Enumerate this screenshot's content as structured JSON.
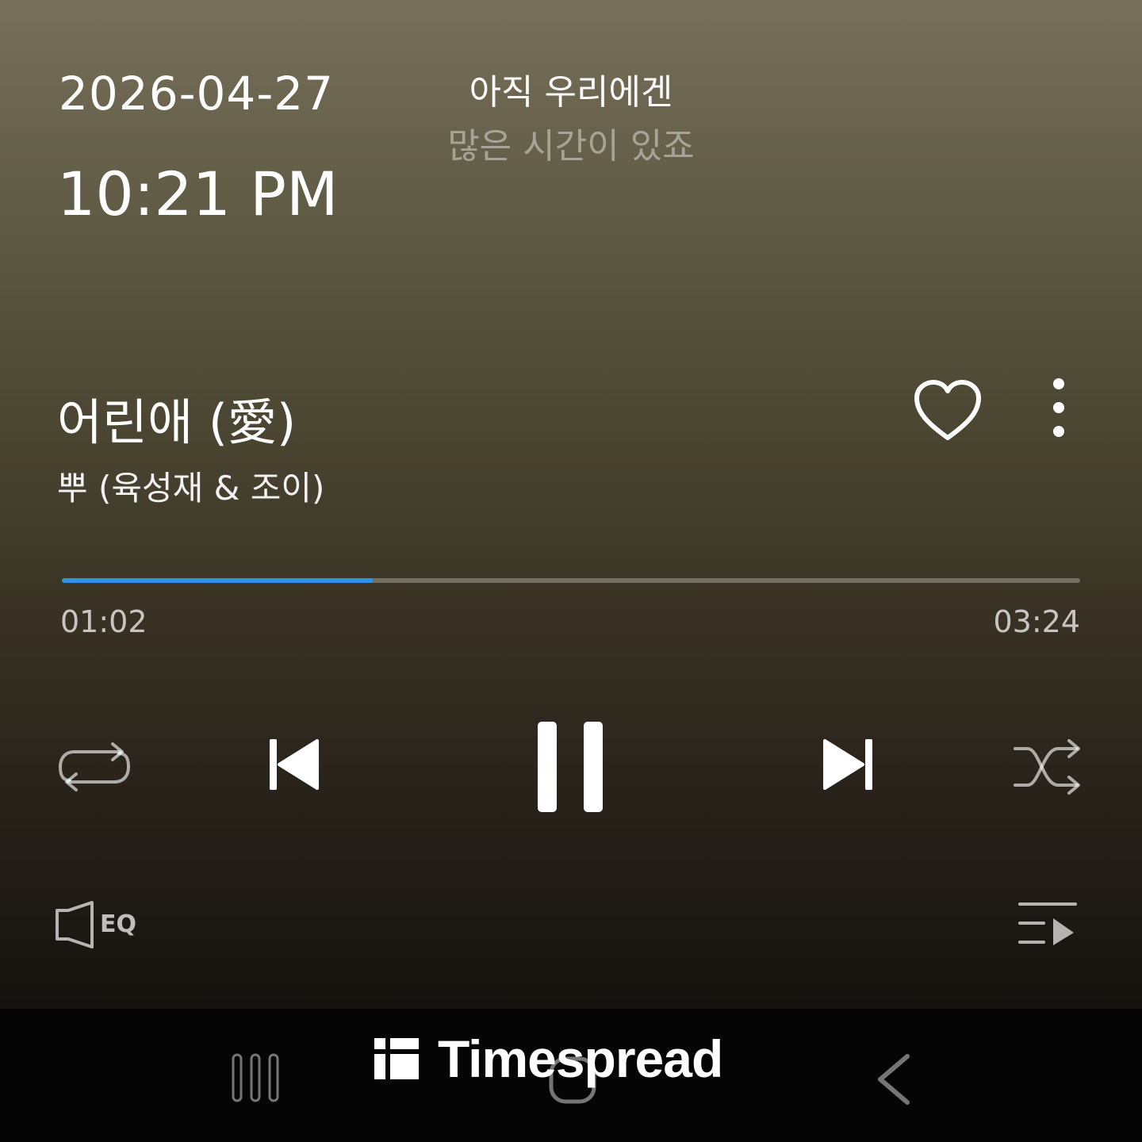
{
  "clock": {
    "date": "2026-04-27",
    "time": "10:21 PM"
  },
  "lyrics": {
    "current": "아직 우리에겐",
    "next": "많은 시간이 있죠"
  },
  "track": {
    "title": "어린애 (愛)",
    "artist": "뿌 (육성재 & 조이)",
    "elapsed": "01:02",
    "duration": "03:24",
    "progress_fraction": 0.305
  },
  "controls": {
    "eq_label": "EQ",
    "icons": [
      "heart-icon",
      "more-vert-icon",
      "repeat-icon",
      "previous-icon",
      "pause-icon",
      "next-icon",
      "shuffle-icon",
      "eq-speaker-icon",
      "queue-icon"
    ]
  },
  "navbar": {
    "icons": [
      "recent-apps-icon",
      "home-icon",
      "back-icon"
    ]
  },
  "watermark": {
    "text": "Timespread"
  },
  "colors": {
    "accent": "#2e93e6",
    "navbar": "#050505"
  }
}
